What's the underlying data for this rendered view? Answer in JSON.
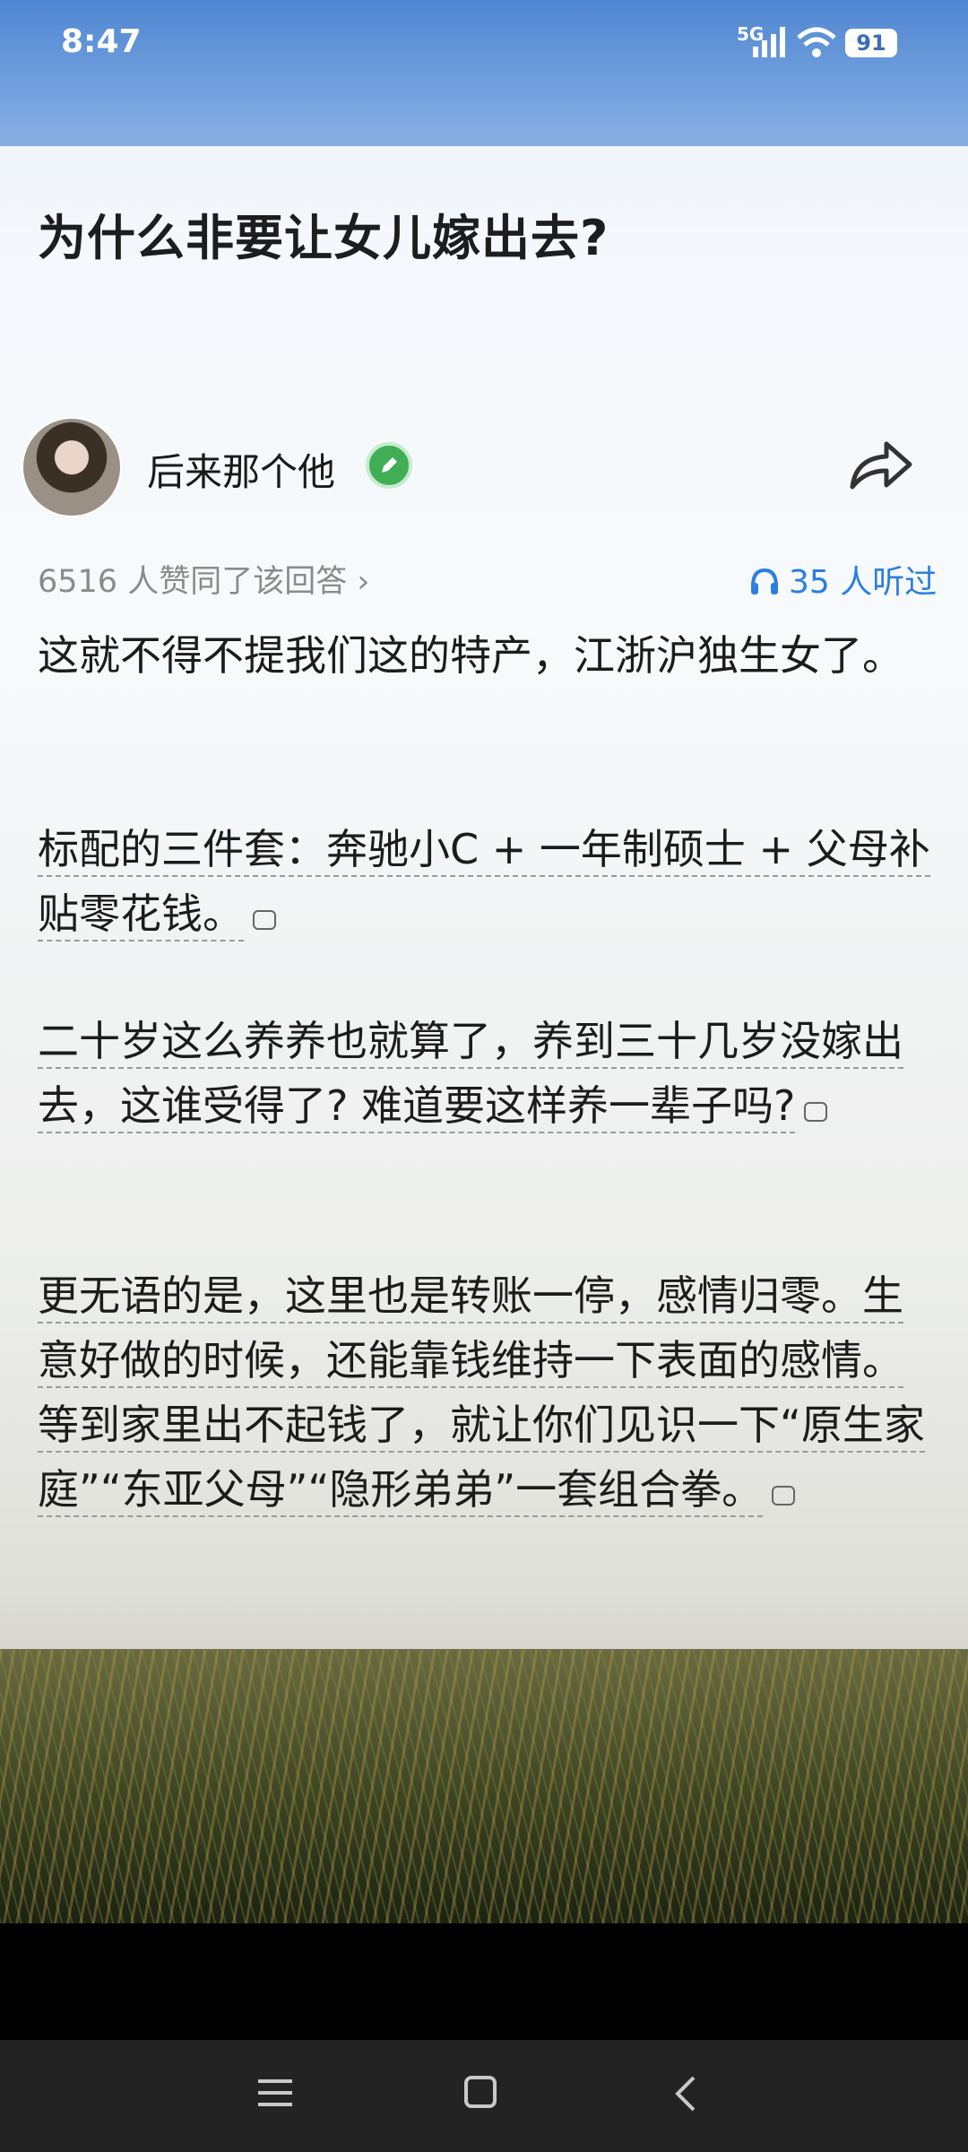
{
  "status_bar": {
    "time": "8:47",
    "network": "5G",
    "battery": "91"
  },
  "question": {
    "title": "为什么非要让女儿嫁出去?"
  },
  "author": {
    "name": "后来那个他"
  },
  "meta": {
    "votes_text": "6516 人赞同了该回答 ›",
    "listen_text": "35 人听过"
  },
  "answer": {
    "p1": "这就不得不提我们这的特产，江浙沪独生女了。",
    "p2": "标配的三件套：奔驰小C + 一年制硕士 + 父母补贴零花钱。",
    "p3": "二十岁这么养养也就算了，养到三十几岁没嫁出去，这谁受得了? 难道要这样养一辈子吗?",
    "p4": "更无语的是，这里也是转账一停，感情归零。生意好做的时候，还能靠钱维持一下表面的感情。等到家里出不起钱了，就让你们见识一下“原生家庭”“东亚父母”“隐形弟弟”一套组合拳。"
  },
  "icons": {
    "share": "share-arrow-icon",
    "listen": "headphones-icon",
    "comment": "comment-bubble-icon",
    "badge": "pencil-badge-icon",
    "nav": [
      "menu-icon",
      "home-icon",
      "back-icon"
    ]
  },
  "colors": {
    "accent": "#2b7fe0",
    "badge": "#3fae54"
  }
}
